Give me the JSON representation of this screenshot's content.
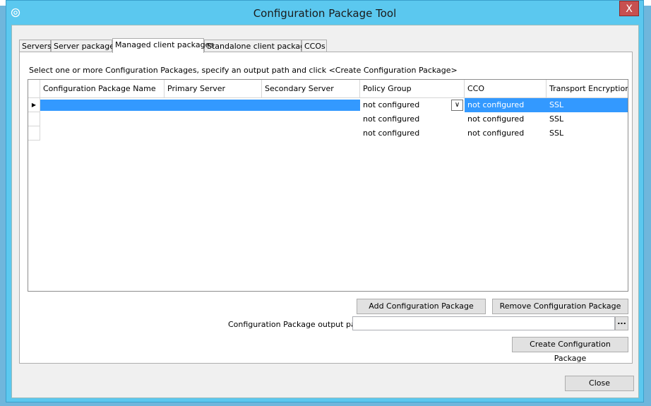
{
  "window": {
    "title": "Configuration Package Tool",
    "close_glyph": "X"
  },
  "tabs": [
    {
      "label": "Servers"
    },
    {
      "label": "Server packages"
    },
    {
      "label": "Managed client packages"
    },
    {
      "label": "Standalone client packages"
    },
    {
      "label": "CCOs"
    }
  ],
  "panel": {
    "instruction": "Select one or more Configuration Packages, specify an output path and click <Create Configuration Package>"
  },
  "grid": {
    "columns": [
      "Configuration Package Name",
      "Primary Server",
      "Secondary Server",
      "Policy Group",
      "CCO",
      "Transport Encryption"
    ],
    "rows": [
      {
        "policy_group": "not configured",
        "cco": "not configured",
        "encryption": "SSL"
      },
      {
        "policy_group": "not configured",
        "cco": "not configured",
        "encryption": "SSL"
      },
      {
        "policy_group": "not configured",
        "cco": "not configured",
        "encryption": "SSL"
      }
    ],
    "current_row_glyph": "▶",
    "dropdown_glyph": "∨"
  },
  "buttons": {
    "add": "Add Configuration Package",
    "remove": "Remove Configuration Package",
    "create": "Create Configuration Package",
    "browse": "...",
    "close": "Close"
  },
  "output": {
    "label": "Configuration Package output path",
    "value": ""
  },
  "colors": {
    "title_bar": "#5bc8ef",
    "selection": "#3399ff",
    "close_button": "#c75050"
  }
}
